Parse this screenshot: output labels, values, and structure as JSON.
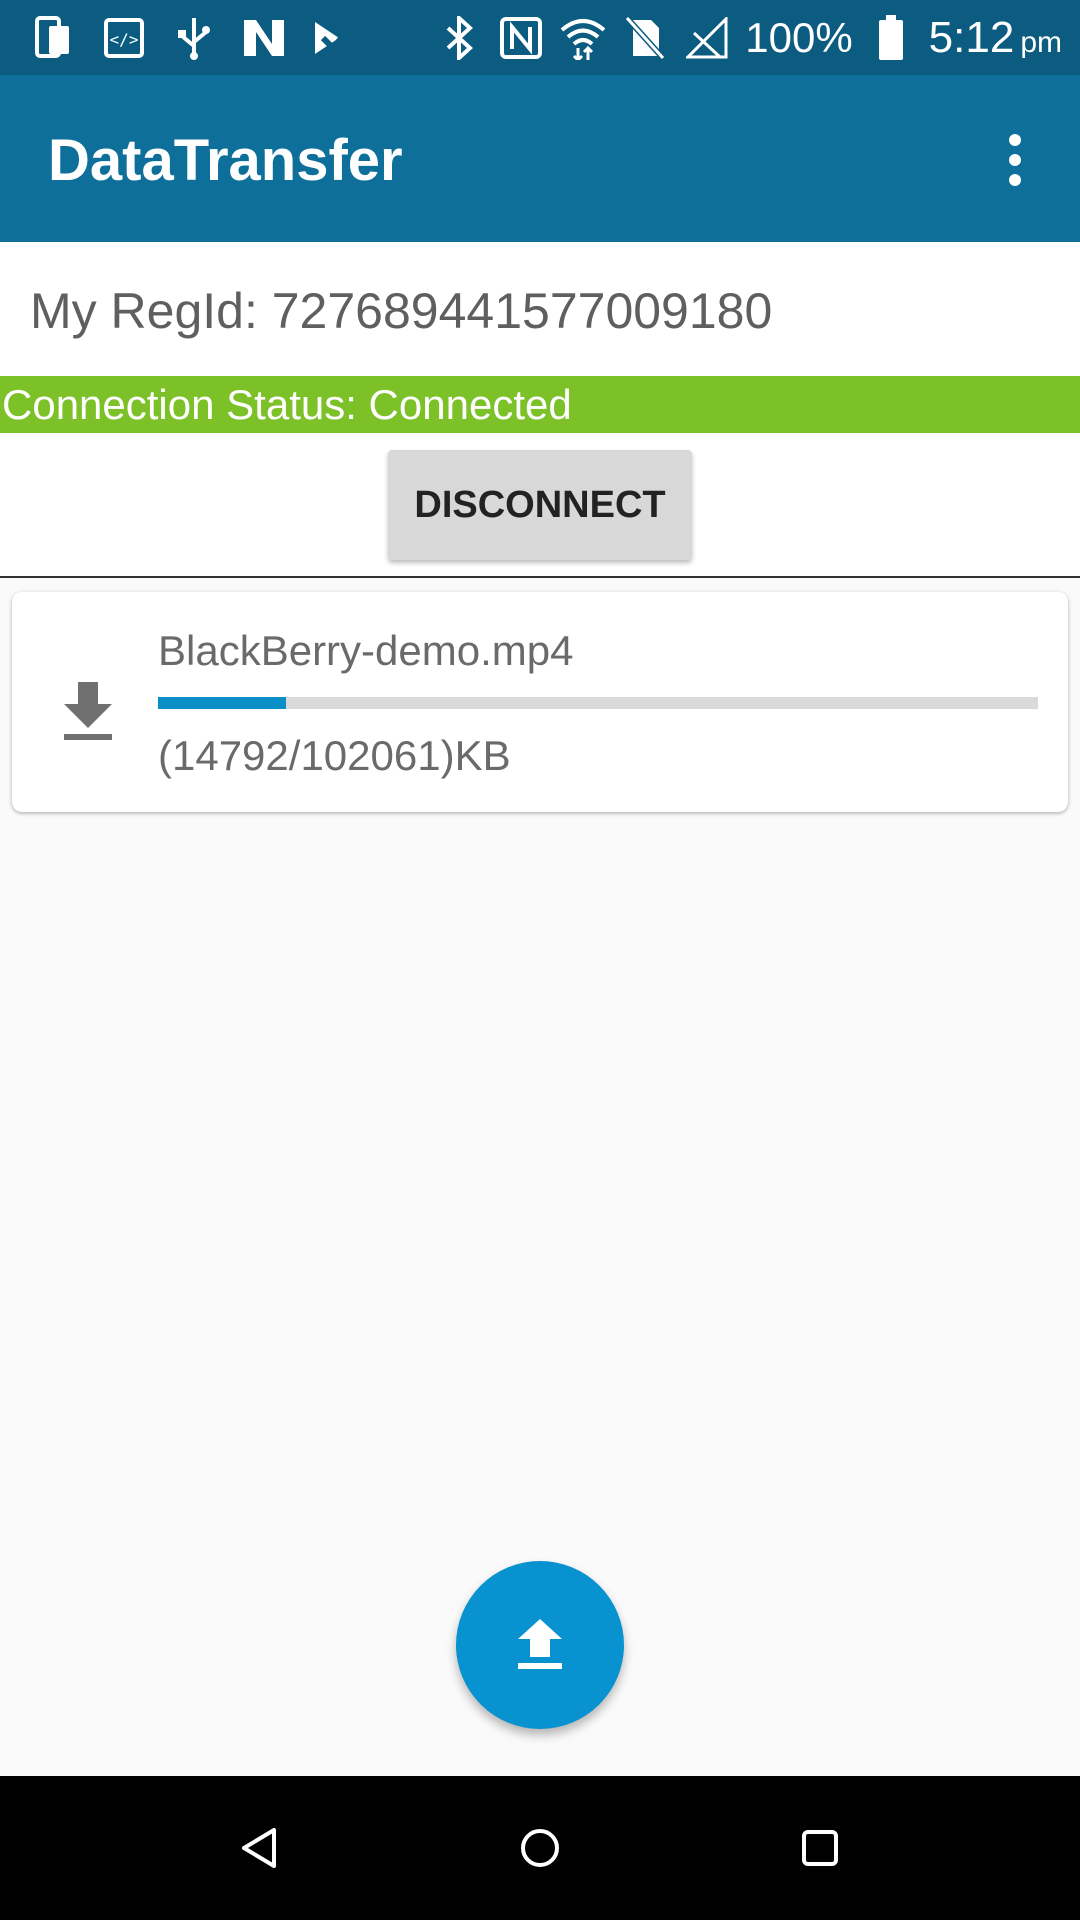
{
  "status_bar": {
    "battery_percent": "100%",
    "time": "5:12",
    "ampm": "pm",
    "left_icons": [
      "phone-icon",
      "code-icon",
      "usb-icon",
      "n-icon",
      "check-icon"
    ],
    "right_icons": [
      "bluetooth-icon",
      "nfc-icon",
      "wifi-icon",
      "no-sim-icon",
      "signal-icon",
      "battery-icon"
    ]
  },
  "app_bar": {
    "title": "DataTransfer",
    "overflow_icon": "more-vert-icon"
  },
  "main": {
    "regid_text": "My RegId: 727689441577009180",
    "connection_status": "Connection Status: Connected",
    "disconnect_label": "DISCONNECT"
  },
  "transfer": {
    "icon": "download-icon",
    "file_name": "BlackBerry-demo.mp4",
    "progress_text": "(14792/102061)KB",
    "progress": 0.145
  },
  "fab": {
    "icon": "upload-icon"
  },
  "nav": {
    "icons": [
      "back-icon",
      "home-icon",
      "recents-icon"
    ]
  },
  "colors": {
    "status_bar": "#0b5c80",
    "app_bar": "#0d6f9a",
    "connected": "#7cc128",
    "progress": "#0b8fc7",
    "fab": "#0892cf"
  }
}
